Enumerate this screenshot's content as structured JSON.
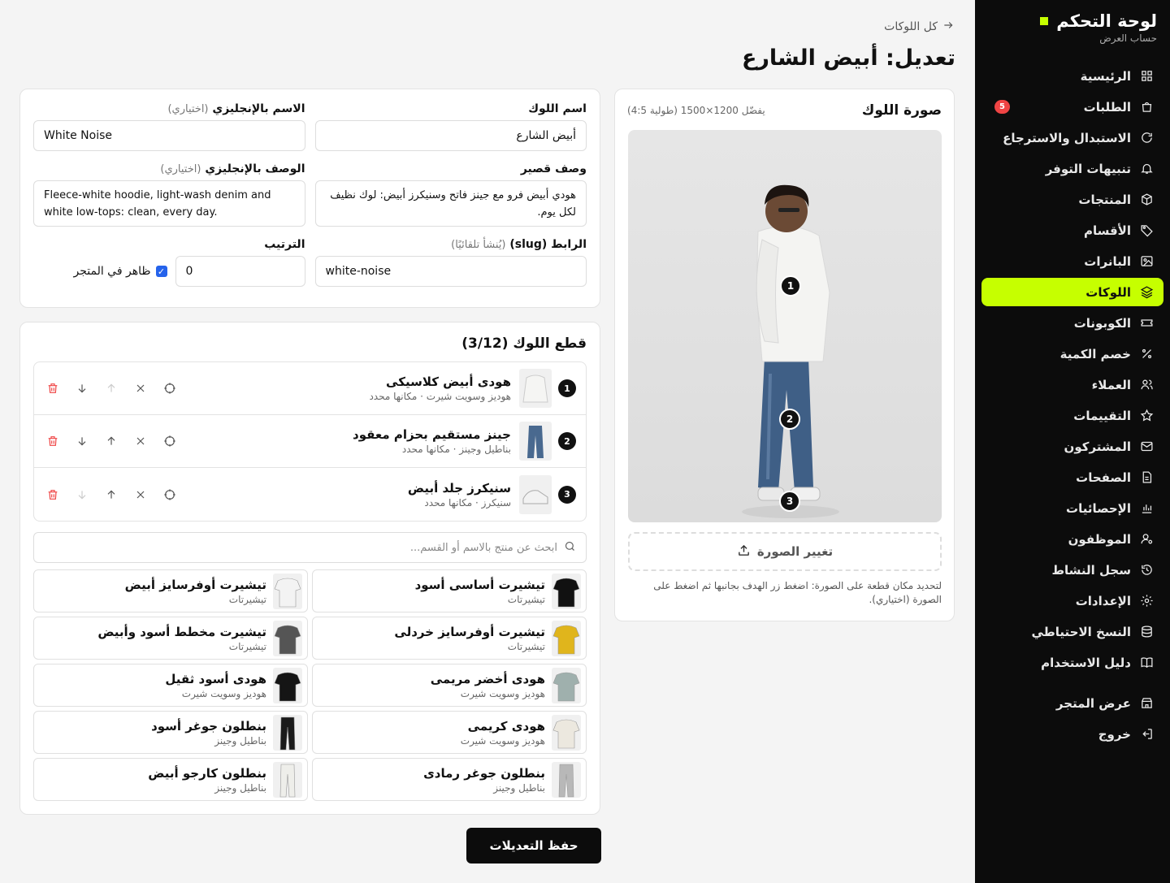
{
  "sidebar": {
    "title": "لوحة التحكم",
    "subtitle": "حساب العرض",
    "items": [
      {
        "label": "الرئيسية",
        "icon": "grid-icon"
      },
      {
        "label": "الطلبات",
        "icon": "bag-icon",
        "badge": "5"
      },
      {
        "label": "الاستبدال والاسترجاع",
        "icon": "refresh-icon"
      },
      {
        "label": "تنبيهات التوفر",
        "icon": "bell-icon"
      },
      {
        "label": "المنتجات",
        "icon": "box-icon"
      },
      {
        "label": "الأقسام",
        "icon": "tag-icon"
      },
      {
        "label": "البانرات",
        "icon": "image-icon"
      },
      {
        "label": "اللوكات",
        "icon": "layers-icon",
        "active": true
      },
      {
        "label": "الكوبونات",
        "icon": "ticket-icon"
      },
      {
        "label": "خصم الكمية",
        "icon": "percent-icon"
      },
      {
        "label": "العملاء",
        "icon": "users-icon"
      },
      {
        "label": "التقييمات",
        "icon": "star-icon"
      },
      {
        "label": "المشتركون",
        "icon": "mail-icon"
      },
      {
        "label": "الصفحات",
        "icon": "file-icon"
      },
      {
        "label": "الإحصائيات",
        "icon": "chart-icon"
      },
      {
        "label": "الموظفون",
        "icon": "user-cog-icon"
      },
      {
        "label": "سجل النشاط",
        "icon": "history-icon"
      },
      {
        "label": "الإعدادات",
        "icon": "gear-icon"
      },
      {
        "label": "النسخ الاحتياطي",
        "icon": "database-icon"
      },
      {
        "label": "دليل الاستخدام",
        "icon": "book-icon"
      }
    ],
    "footer": [
      {
        "label": "عرض المتجر",
        "icon": "store-icon"
      },
      {
        "label": "خروج",
        "icon": "logout-icon"
      }
    ]
  },
  "header": {
    "back_label": "كل اللوكات",
    "title": "تعديل: أبيض الشارع"
  },
  "form": {
    "name_label": "اسم اللوك",
    "name_value": "أبيض الشارع",
    "name_en_label": "الاسم بالإنجليزي",
    "optional": "(اختياري)",
    "name_en_value": "White Noise",
    "desc_label": "وصف قصير",
    "desc_value": "هودي أبيض فرو مع جينز فاتح وسنيكرز أبيض: لوك نظيف لكل يوم.",
    "desc_en_label": "الوصف بالإنجليزي",
    "desc_en_value": "Fleece-white hoodie, light-wash denim and white low-tops: clean, every day.",
    "slug_label": "الرابط (slug)",
    "slug_hint": "(يُنشأ تلقائيًا)",
    "slug_value": "white-noise",
    "order_label": "الترتيب",
    "order_value": "0",
    "visible_label": "ظاهر في المتجر",
    "visible_checked": true
  },
  "image_card": {
    "title": "صورة اللوك",
    "hint": "يفضّل 1200×1500 (طولية 4:5)",
    "change_label": "تغيير الصورة",
    "note": "لتحديد مكان قطعة على الصورة: اضغط زر الهدف بجانبها ثم اضغط على الصورة (اختياري).",
    "pins": [
      "1",
      "2",
      "3"
    ]
  },
  "pieces": {
    "title": "قطع اللوك (3/12)",
    "items": [
      {
        "num": "1",
        "title": "هودى أبيض كلاسيكى",
        "sub": "هوديز وسويت شيرت · مكانها محدد"
      },
      {
        "num": "2",
        "title": "جينز مستقيم بحزام معقود",
        "sub": "بناطيل وجينز · مكانها محدد"
      },
      {
        "num": "3",
        "title": "سنيكرز جلد أبيض",
        "sub": "سنيكرز · مكانها محدد"
      }
    ],
    "search_placeholder": "ابحث عن منتج بالاسم أو القسم...",
    "products": [
      {
        "title": "تيشيرت أساسى أسود",
        "sub": "تيشيرتات",
        "color": "#111"
      },
      {
        "title": "تيشيرت أوفرسايز أبيض",
        "sub": "تيشيرتات",
        "color": "#f3f3f3"
      },
      {
        "title": "تيشيرت أوفرسايز خردلى",
        "sub": "تيشيرتات",
        "color": "#e0b51c"
      },
      {
        "title": "تيشيرت مخطط أسود وأبيض",
        "sub": "تيشيرتات",
        "color": "#555"
      },
      {
        "title": "هودى أخضر مريمى",
        "sub": "هوديز وسويت شيرت",
        "color": "#9fb0ad"
      },
      {
        "title": "هودى أسود ثقيل",
        "sub": "هوديز وسويت شيرت",
        "color": "#151515"
      },
      {
        "title": "هودى كريمى",
        "sub": "هوديز وسويت شيرت",
        "color": "#ece8df"
      },
      {
        "title": "بنطلون جوغر أسود",
        "sub": "بناطيل وجينز",
        "color": "#1a1a1a"
      },
      {
        "title": "بنطلون جوغر رمادى",
        "sub": "بناطيل وجينز",
        "color": "#b8b8b8"
      },
      {
        "title": "بنطلون كارجو أبيض",
        "sub": "بناطيل وجينز",
        "color": "#eeeeea"
      }
    ]
  },
  "save_label": "حفظ التعديلات",
  "colors": {
    "accent": "#c6ff00",
    "badge": "#ef4444",
    "sidebar_bg": "#0c0c0c"
  }
}
